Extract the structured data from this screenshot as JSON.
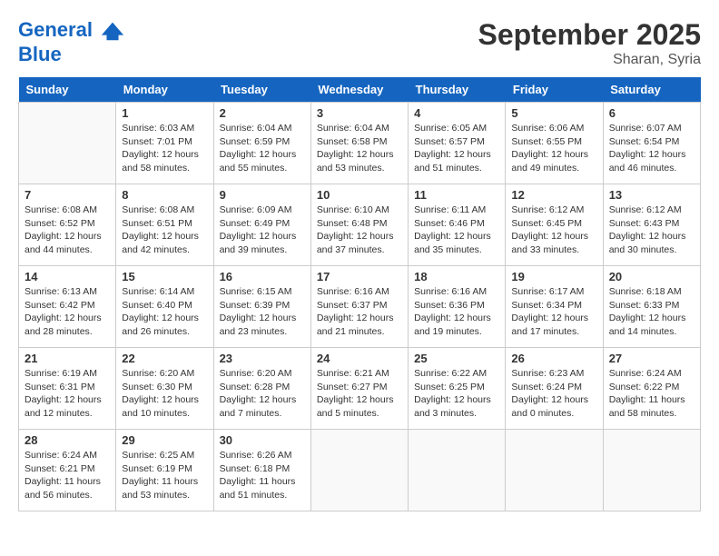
{
  "header": {
    "logo_line1": "General",
    "logo_line2": "Blue",
    "month": "September 2025",
    "location": "Sharan, Syria"
  },
  "days_of_week": [
    "Sunday",
    "Monday",
    "Tuesday",
    "Wednesday",
    "Thursday",
    "Friday",
    "Saturday"
  ],
  "weeks": [
    [
      {
        "date": "",
        "info": ""
      },
      {
        "date": "1",
        "info": "Sunrise: 6:03 AM\nSunset: 7:01 PM\nDaylight: 12 hours and 58 minutes."
      },
      {
        "date": "2",
        "info": "Sunrise: 6:04 AM\nSunset: 6:59 PM\nDaylight: 12 hours and 55 minutes."
      },
      {
        "date": "3",
        "info": "Sunrise: 6:04 AM\nSunset: 6:58 PM\nDaylight: 12 hours and 53 minutes."
      },
      {
        "date": "4",
        "info": "Sunrise: 6:05 AM\nSunset: 6:57 PM\nDaylight: 12 hours and 51 minutes."
      },
      {
        "date": "5",
        "info": "Sunrise: 6:06 AM\nSunset: 6:55 PM\nDaylight: 12 hours and 49 minutes."
      },
      {
        "date": "6",
        "info": "Sunrise: 6:07 AM\nSunset: 6:54 PM\nDaylight: 12 hours and 46 minutes."
      }
    ],
    [
      {
        "date": "7",
        "info": "Sunrise: 6:08 AM\nSunset: 6:52 PM\nDaylight: 12 hours and 44 minutes."
      },
      {
        "date": "8",
        "info": "Sunrise: 6:08 AM\nSunset: 6:51 PM\nDaylight: 12 hours and 42 minutes."
      },
      {
        "date": "9",
        "info": "Sunrise: 6:09 AM\nSunset: 6:49 PM\nDaylight: 12 hours and 39 minutes."
      },
      {
        "date": "10",
        "info": "Sunrise: 6:10 AM\nSunset: 6:48 PM\nDaylight: 12 hours and 37 minutes."
      },
      {
        "date": "11",
        "info": "Sunrise: 6:11 AM\nSunset: 6:46 PM\nDaylight: 12 hours and 35 minutes."
      },
      {
        "date": "12",
        "info": "Sunrise: 6:12 AM\nSunset: 6:45 PM\nDaylight: 12 hours and 33 minutes."
      },
      {
        "date": "13",
        "info": "Sunrise: 6:12 AM\nSunset: 6:43 PM\nDaylight: 12 hours and 30 minutes."
      }
    ],
    [
      {
        "date": "14",
        "info": "Sunrise: 6:13 AM\nSunset: 6:42 PM\nDaylight: 12 hours and 28 minutes."
      },
      {
        "date": "15",
        "info": "Sunrise: 6:14 AM\nSunset: 6:40 PM\nDaylight: 12 hours and 26 minutes."
      },
      {
        "date": "16",
        "info": "Sunrise: 6:15 AM\nSunset: 6:39 PM\nDaylight: 12 hours and 23 minutes."
      },
      {
        "date": "17",
        "info": "Sunrise: 6:16 AM\nSunset: 6:37 PM\nDaylight: 12 hours and 21 minutes."
      },
      {
        "date": "18",
        "info": "Sunrise: 6:16 AM\nSunset: 6:36 PM\nDaylight: 12 hours and 19 minutes."
      },
      {
        "date": "19",
        "info": "Sunrise: 6:17 AM\nSunset: 6:34 PM\nDaylight: 12 hours and 17 minutes."
      },
      {
        "date": "20",
        "info": "Sunrise: 6:18 AM\nSunset: 6:33 PM\nDaylight: 12 hours and 14 minutes."
      }
    ],
    [
      {
        "date": "21",
        "info": "Sunrise: 6:19 AM\nSunset: 6:31 PM\nDaylight: 12 hours and 12 minutes."
      },
      {
        "date": "22",
        "info": "Sunrise: 6:20 AM\nSunset: 6:30 PM\nDaylight: 12 hours and 10 minutes."
      },
      {
        "date": "23",
        "info": "Sunrise: 6:20 AM\nSunset: 6:28 PM\nDaylight: 12 hours and 7 minutes."
      },
      {
        "date": "24",
        "info": "Sunrise: 6:21 AM\nSunset: 6:27 PM\nDaylight: 12 hours and 5 minutes."
      },
      {
        "date": "25",
        "info": "Sunrise: 6:22 AM\nSunset: 6:25 PM\nDaylight: 12 hours and 3 minutes."
      },
      {
        "date": "26",
        "info": "Sunrise: 6:23 AM\nSunset: 6:24 PM\nDaylight: 12 hours and 0 minutes."
      },
      {
        "date": "27",
        "info": "Sunrise: 6:24 AM\nSunset: 6:22 PM\nDaylight: 11 hours and 58 minutes."
      }
    ],
    [
      {
        "date": "28",
        "info": "Sunrise: 6:24 AM\nSunset: 6:21 PM\nDaylight: 11 hours and 56 minutes."
      },
      {
        "date": "29",
        "info": "Sunrise: 6:25 AM\nSunset: 6:19 PM\nDaylight: 11 hours and 53 minutes."
      },
      {
        "date": "30",
        "info": "Sunrise: 6:26 AM\nSunset: 6:18 PM\nDaylight: 11 hours and 51 minutes."
      },
      {
        "date": "",
        "info": ""
      },
      {
        "date": "",
        "info": ""
      },
      {
        "date": "",
        "info": ""
      },
      {
        "date": "",
        "info": ""
      }
    ]
  ]
}
